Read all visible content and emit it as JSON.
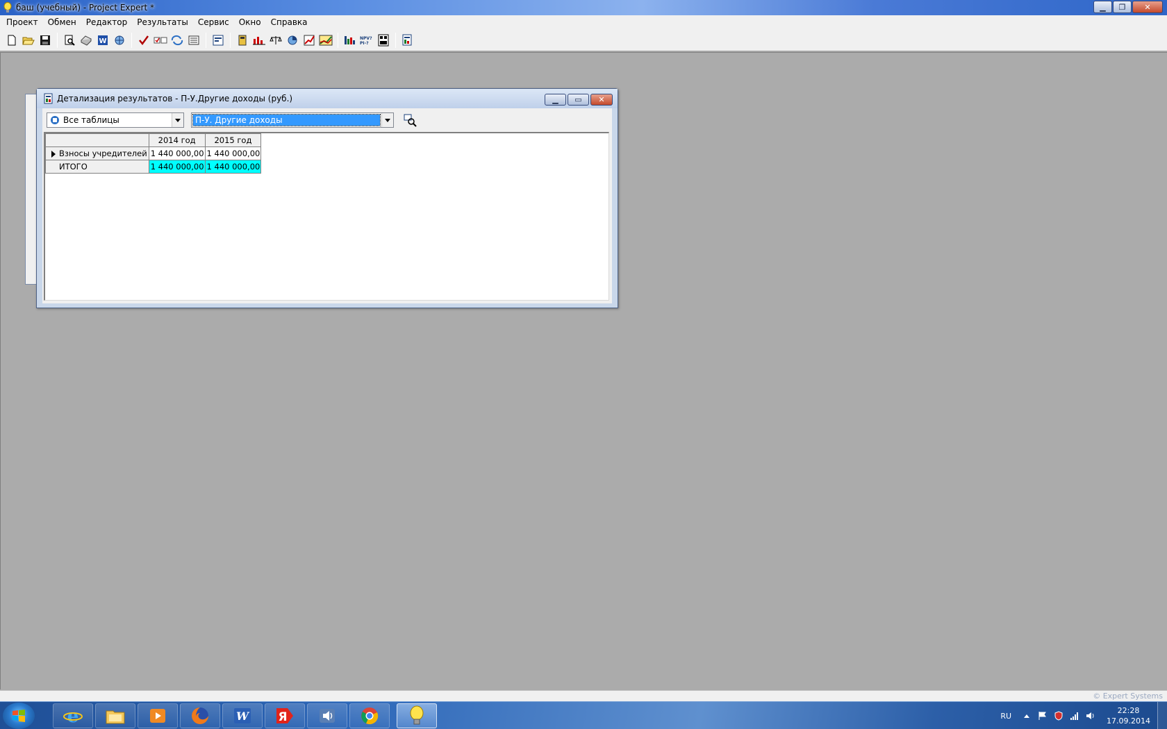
{
  "app": {
    "title": "баш (учебный) - Project Expert *"
  },
  "menu": [
    "Проект",
    "Обмен",
    "Редактор",
    "Результаты",
    "Сервис",
    "Окно",
    "Справка"
  ],
  "toolbar": {
    "icons": [
      "new-file-icon",
      "open-folder-icon",
      "save-disk-icon",
      "print-preview-icon",
      "print-icon",
      "word-icon",
      "web-export-icon",
      "check-icon",
      "calculate-icon",
      "refresh-icon",
      "list-icon",
      "report-icon",
      "table-icon",
      "chart-icon",
      "balance-icon",
      "analysis-icon",
      "graph-icon",
      "trend-chart-icon",
      "bar-chart-icon",
      "npv-pi-icon",
      "monte-carlo-icon",
      "detail-results-icon"
    ]
  },
  "child_window": {
    "title": "Детализация результатов - П-У.Другие доходы (руб.)",
    "combo_tables": {
      "value": "Все таблицы"
    },
    "combo_item": {
      "value": "П-У. Другие доходы"
    }
  },
  "grid": {
    "columns": [
      "2014 год",
      "2015 год"
    ],
    "rows": [
      {
        "label": "Взносы учредителей",
        "values": [
          "1 440 000,00",
          "1 440 000,00"
        ]
      },
      {
        "label": "ИТОГО",
        "values": [
          "1 440 000,00",
          "1 440 000,00"
        ]
      }
    ]
  },
  "statusbar": {
    "copyright": "© Expert Systems"
  },
  "taskbar": {
    "apps": [
      "internet-explorer-icon",
      "file-explorer-icon",
      "media-player-icon",
      "firefox-icon",
      "word-icon",
      "yandex-icon",
      "audio-icon",
      "chrome-icon",
      "project-expert-icon"
    ],
    "tray": {
      "language": "RU",
      "time": "22:28",
      "date": "17.09.2014"
    }
  },
  "colors": {
    "mdi_background": "#ababab",
    "total_cell": "#00ffff",
    "selection": "#3399ff"
  }
}
